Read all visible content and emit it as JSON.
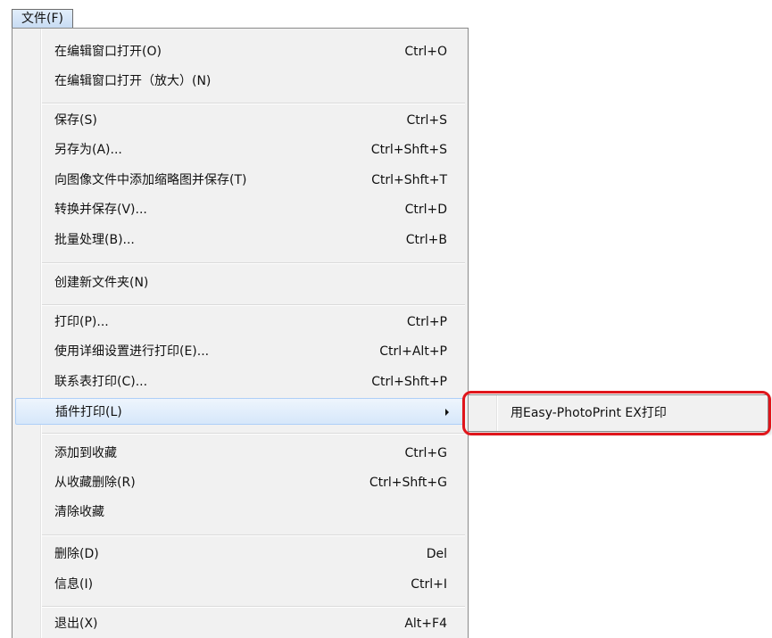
{
  "menubar": {
    "title": "文件(F)"
  },
  "menu": {
    "items": [
      {
        "label": "在编辑窗口打开(O)",
        "shortcut": "Ctrl+O"
      },
      {
        "label": "在编辑窗口打开（放大）(N)",
        "shortcut": ""
      },
      {
        "label": "保存(S)",
        "shortcut": "Ctrl+S"
      },
      {
        "label": "另存为(A)...",
        "shortcut": "Ctrl+Shft+S"
      },
      {
        "label": "向图像文件中添加缩略图并保存(T)",
        "shortcut": "Ctrl+Shft+T"
      },
      {
        "label": "转换并保存(V)...",
        "shortcut": "Ctrl+D"
      },
      {
        "label": "批量处理(B)...",
        "shortcut": "Ctrl+B"
      },
      {
        "label": "创建新文件夹(N)",
        "shortcut": ""
      },
      {
        "label": "打印(P)...",
        "shortcut": "Ctrl+P"
      },
      {
        "label": "使用详细设置进行打印(E)...",
        "shortcut": "Ctrl+Alt+P"
      },
      {
        "label": "联系表打印(C)...",
        "shortcut": "Ctrl+Shft+P"
      },
      {
        "label": "插件打印(L)",
        "shortcut": ""
      },
      {
        "label": "添加到收藏",
        "shortcut": "Ctrl+G"
      },
      {
        "label": "从收藏删除(R)",
        "shortcut": "Ctrl+Shft+G"
      },
      {
        "label": "清除收藏",
        "shortcut": ""
      },
      {
        "label": "删除(D)",
        "shortcut": "Del"
      },
      {
        "label": "信息(I)",
        "shortcut": "Ctrl+I"
      },
      {
        "label": "退出(X)",
        "shortcut": "Alt+F4"
      }
    ]
  },
  "submenu": {
    "items": [
      {
        "label": "用Easy-PhotoPrint EX打印"
      }
    ]
  },
  "colors": {
    "callout": "#e0151b",
    "highlight": "#d6e7fa",
    "menu_background": "#f1f1f1"
  }
}
